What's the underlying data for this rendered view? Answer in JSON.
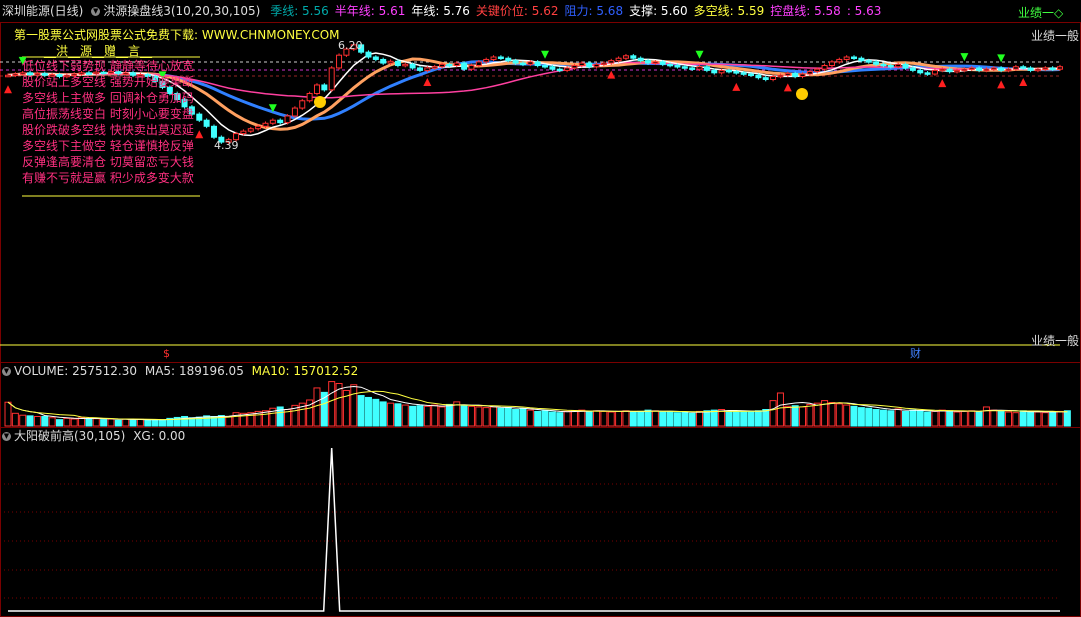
{
  "header": {
    "stock_name": "深圳能源(日线)",
    "indicator_name": "洪源操盘线3(10,20,30,105)",
    "items": [
      {
        "label": "季线:",
        "value": "5.56",
        "color": "#00a8a8"
      },
      {
        "label": "半年线:",
        "value": "5.61",
        "color": "#ff40ff"
      },
      {
        "label": "年线:",
        "value": "5.76",
        "color": "#ffffff"
      },
      {
        "label": "关键价位:",
        "value": "5.62",
        "color": "#ff4040"
      },
      {
        "label": "阻力:",
        "value": "5.68",
        "color": "#3060ff"
      },
      {
        "label": "支撑:",
        "value": "5.60",
        "color": "#ffffff"
      },
      {
        "label": "多空线:",
        "value": "5.59",
        "color": "#ffff40"
      },
      {
        "label": "控盘线:",
        "value": "5.58",
        "color": "#ff40ff"
      },
      {
        "label": ":",
        "value": "5.63",
        "color": "#ff40ff"
      }
    ],
    "right_label": "业绩一◇"
  },
  "price_panel": {
    "right_tag_top": "业绩一般",
    "right_tag_bottom": "业绩一般",
    "max_label": "6.20",
    "min_label": "4.39",
    "dollar_mark": "$",
    "cai_mark": "财",
    "ad_line": "第一股票公式网股票公式免费下载: WWW.CHNMONEY.COM",
    "poem_title": "__洪__源__赠__言__",
    "poem": [
      "低位线下弱势现 静静等待心放宽",
      "股价站上多空线 强势开始要果断",
      "多空线上主做多 回调补仓勇加码",
      "高位振荡线变白 时刻小心要变盘",
      "股价跌破多空线 快快卖出莫迟延",
      "多空线下主做空 轻仓谨慎抢反弹",
      "反弹逢高要清仓 切莫留恋亏大钱",
      "有赚不亏就是赢 积少成多变大款"
    ]
  },
  "volume_panel": {
    "label": "VOLUME:",
    "value": "257512.30",
    "ma5_label": "MA5:",
    "ma5_value": "189196.05",
    "ma10_label": "MA10:",
    "ma10_value": "157012.52"
  },
  "signal_panel": {
    "label": "大阳破前高(30,105)",
    "xg_label": "XG:",
    "xg_value": "0.00"
  },
  "chart_data": {
    "type": "candlestick",
    "closes": [
      5.62,
      5.64,
      5.66,
      5.63,
      5.65,
      5.62,
      5.63,
      5.6,
      5.62,
      5.64,
      5.66,
      5.65,
      5.67,
      5.66,
      5.68,
      5.65,
      5.66,
      5.62,
      5.63,
      5.6,
      5.52,
      5.42,
      5.32,
      5.22,
      5.1,
      4.98,
      4.88,
      4.78,
      4.6,
      4.52,
      4.56,
      4.66,
      4.7,
      4.74,
      4.78,
      4.83,
      4.88,
      4.84,
      4.95,
      5.08,
      5.2,
      5.32,
      5.46,
      5.38,
      5.74,
      5.95,
      6.05,
      6.12,
      6.0,
      5.92,
      5.88,
      5.82,
      5.85,
      5.78,
      5.8,
      5.74,
      5.7,
      5.74,
      5.76,
      5.8,
      5.78,
      5.82,
      5.72,
      5.78,
      5.84,
      5.88,
      5.92,
      5.9,
      5.86,
      5.82,
      5.8,
      5.84,
      5.78,
      5.76,
      5.72,
      5.7,
      5.74,
      5.78,
      5.82,
      5.76,
      5.8,
      5.82,
      5.86,
      5.9,
      5.94,
      5.9,
      5.86,
      5.82,
      5.84,
      5.8,
      5.78,
      5.76,
      5.74,
      5.72,
      5.76,
      5.7,
      5.66,
      5.7,
      5.68,
      5.66,
      5.64,
      5.62,
      5.58,
      5.55,
      5.6,
      5.62,
      5.65,
      5.6,
      5.64,
      5.68,
      5.72,
      5.78,
      5.84,
      5.88,
      5.92,
      5.9,
      5.86,
      5.84,
      5.8,
      5.78,
      5.76,
      5.8,
      5.74,
      5.7,
      5.66,
      5.64,
      5.7,
      5.72,
      5.68,
      5.7,
      5.72,
      5.74,
      5.7,
      5.72,
      5.74,
      5.7,
      5.72,
      5.76,
      5.74,
      5.7,
      5.72,
      5.74,
      5.72,
      5.76
    ],
    "volume": [
      7.5,
      4.0,
      3.4,
      3.2,
      3.0,
      3.0,
      2.6,
      2.0,
      2.4,
      2.2,
      2.6,
      2.4,
      2.3,
      2.0,
      2.2,
      1.8,
      2.2,
      2.0,
      2.1,
      1.8,
      2.0,
      1.9,
      2.4,
      2.7,
      3.0,
      2.6,
      2.8,
      3.2,
      3.0,
      3.3,
      3.0,
      4.2,
      4.0,
      4.2,
      4.6,
      4.8,
      5.6,
      6.0,
      5.2,
      6.5,
      7.2,
      8.2,
      12.0,
      10.6,
      14.0,
      13.4,
      11.2,
      13.0,
      9.6,
      9.0,
      8.4,
      7.6,
      7.2,
      7.0,
      6.6,
      6.2,
      6.4,
      6.2,
      6.6,
      6.0,
      6.8,
      7.6,
      6.4,
      6.2,
      6.0,
      5.8,
      6.0,
      5.6,
      5.8,
      5.2,
      5.4,
      5.0,
      4.6,
      4.8,
      4.4,
      4.2,
      4.6,
      4.8,
      5.0,
      4.6,
      4.8,
      4.6,
      4.4,
      4.6,
      4.8,
      4.4,
      4.6,
      5.0,
      4.8,
      4.4,
      4.6,
      4.2,
      4.4,
      4.0,
      4.6,
      4.8,
      5.0,
      5.2,
      4.8,
      4.6,
      4.4,
      4.6,
      4.8,
      5.2,
      8.0,
      10.4,
      6.2,
      6.4,
      6.0,
      6.8,
      7.2,
      8.0,
      7.4,
      7.0,
      6.6,
      6.2,
      5.8,
      5.6,
      5.2,
      5.0,
      4.8,
      5.4,
      4.6,
      5.0,
      4.8,
      4.4,
      4.6,
      5.0,
      4.8,
      4.4,
      4.6,
      4.8,
      4.4,
      6.0,
      5.0,
      4.6,
      4.4,
      4.2,
      4.8,
      4.6,
      4.4,
      4.2,
      4.4,
      4.6,
      4.8
    ],
    "max_price": 6.2,
    "min_price": 4.39,
    "signal_spike_index": 44,
    "signal_spike_value": 1.0
  }
}
